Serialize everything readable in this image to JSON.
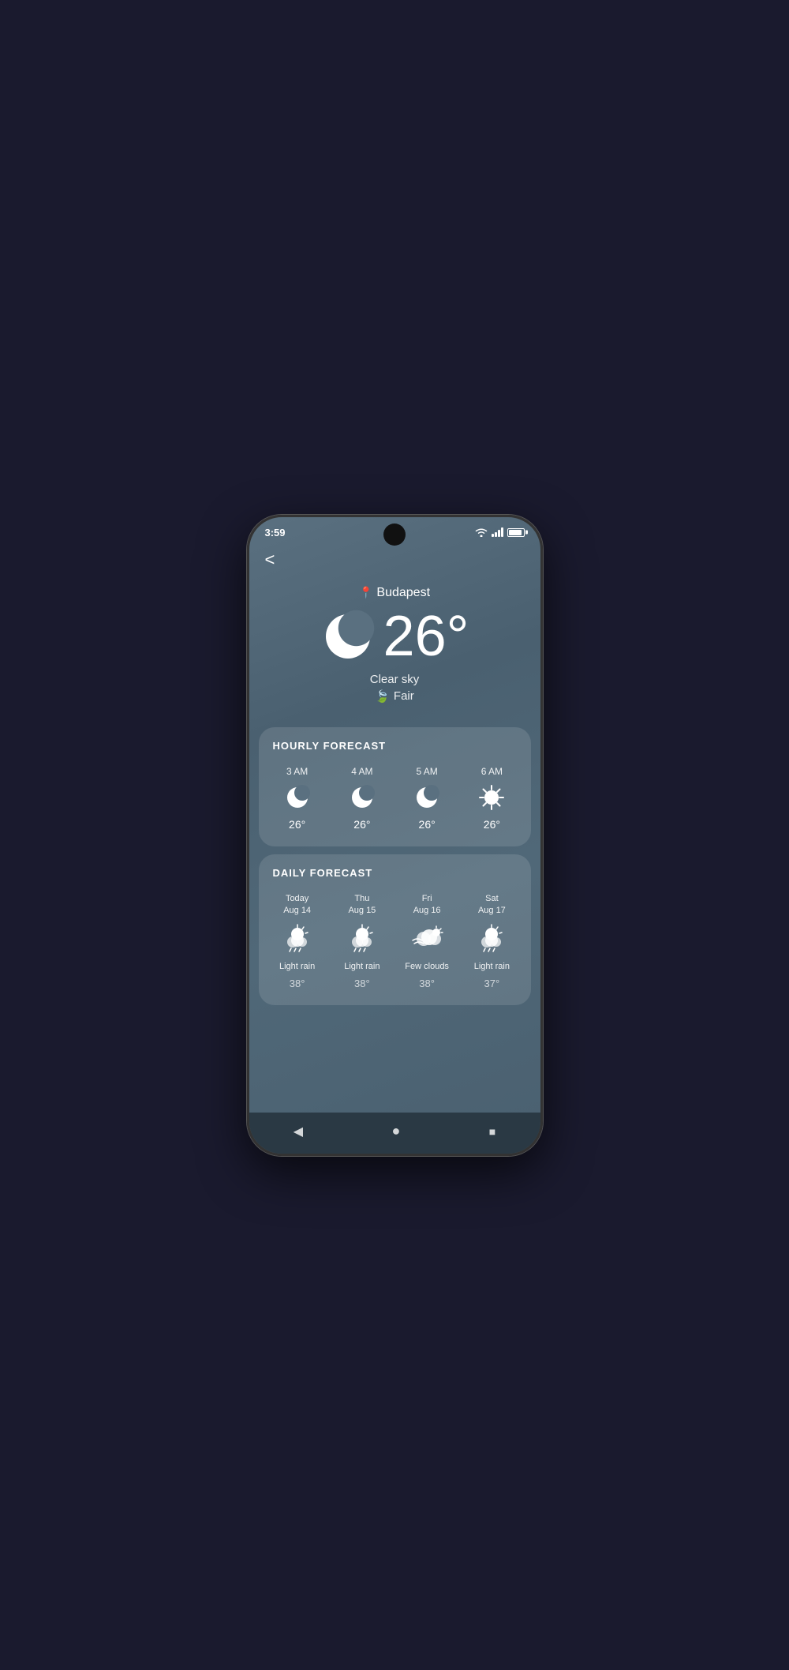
{
  "statusBar": {
    "time": "3:59",
    "wifi": true,
    "signal": true,
    "battery": true
  },
  "header": {
    "backLabel": "<"
  },
  "mainWeather": {
    "city": "Budapest",
    "temperature": "26°",
    "description": "Clear sky",
    "quality": "Fair"
  },
  "hourlyForecast": {
    "title": "HOURLY FORECAST",
    "items": [
      {
        "time": "3 AM",
        "icon": "crescent-moon",
        "temp": "26°"
      },
      {
        "time": "4 AM",
        "icon": "crescent-moon",
        "temp": "26°"
      },
      {
        "time": "5 AM",
        "icon": "crescent-moon",
        "temp": "26°"
      },
      {
        "time": "6 AM",
        "icon": "sun",
        "temp": "26°"
      }
    ]
  },
  "dailyForecast": {
    "title": "DAILY FORECAST",
    "items": [
      {
        "day": "Today",
        "date": "Aug 14",
        "icon": "rain-sun",
        "desc": "Light rain",
        "temp": "38°"
      },
      {
        "day": "Thu",
        "date": "Aug 15",
        "icon": "rain-sun",
        "desc": "Light rain",
        "temp": "38°"
      },
      {
        "day": "Fri",
        "date": "Aug 16",
        "icon": "wind-cloud",
        "desc": "Few clouds",
        "temp": "38°"
      },
      {
        "day": "Sat",
        "date": "Aug 17",
        "icon": "rain-sun",
        "desc": "Light rain",
        "temp": "37°"
      }
    ]
  },
  "navBar": {
    "back": "◀",
    "home": "●",
    "square": "■"
  }
}
